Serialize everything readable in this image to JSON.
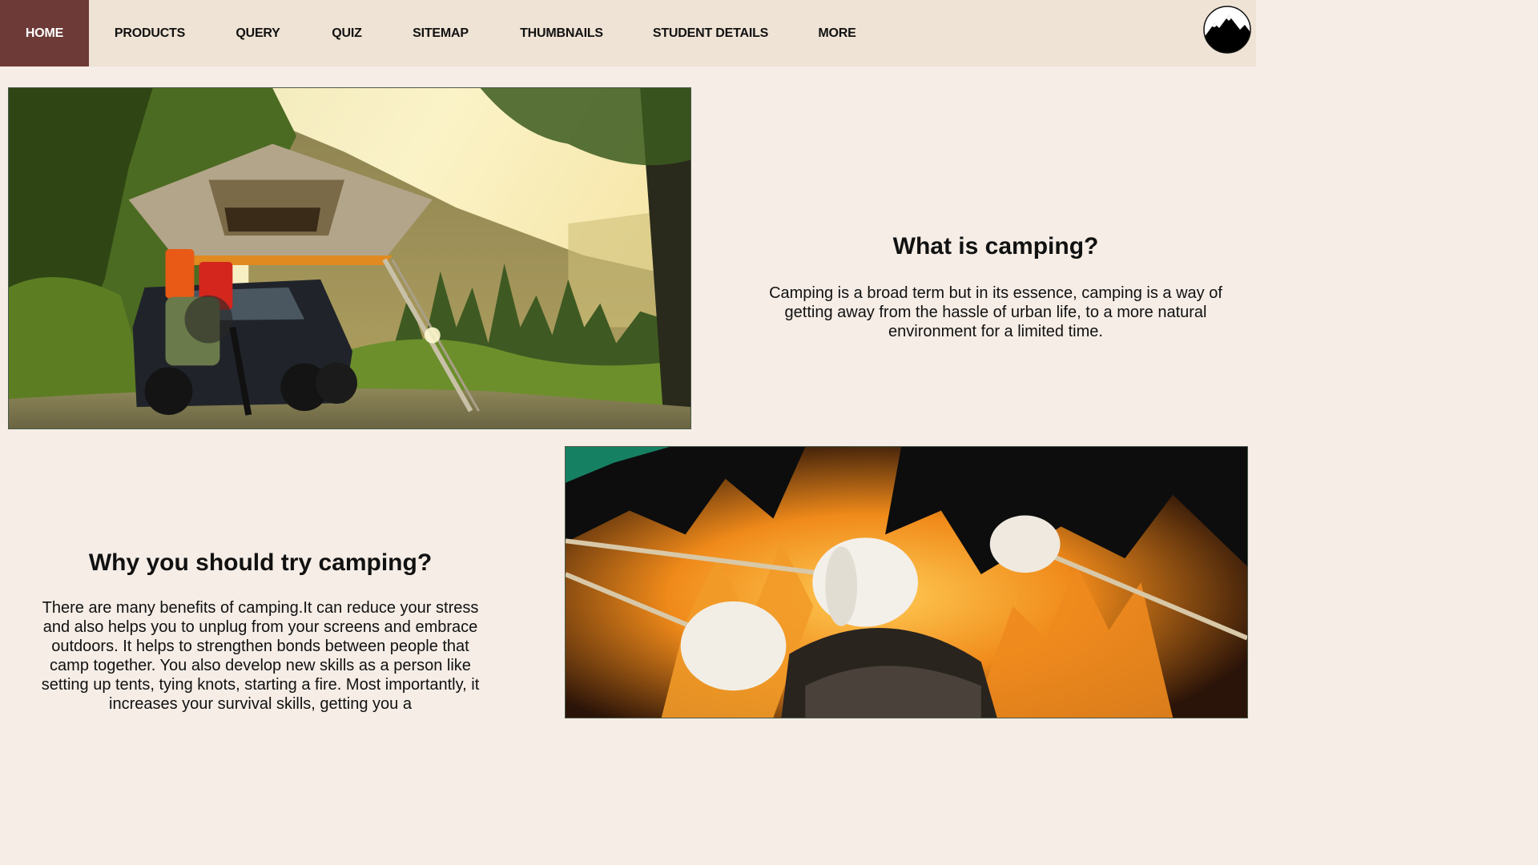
{
  "nav": {
    "items": [
      {
        "label": "HOME",
        "active": true
      },
      {
        "label": "PRODUCTS"
      },
      {
        "label": "QUERY"
      },
      {
        "label": "QUIZ"
      },
      {
        "label": "SITEMAP"
      },
      {
        "label": "THUMBNAILS"
      },
      {
        "label": "STUDENT DETAILS"
      },
      {
        "label": "MORE"
      }
    ],
    "logo_icon": "mountain-logo-icon"
  },
  "section1": {
    "title": "What is camping?",
    "body": "Camping is a broad term but in its essence, camping is a way of getting away from the hassle of urban life, to a more natural environment for a limited time.",
    "image_icon": "camping-car-tent-photo"
  },
  "section2": {
    "title": "Why you should try camping?",
    "body": "There are many benefits of camping.It can reduce your stress and also helps you to unplug from your screens and embrace outdoors. It helps to strengthen bonds between people that camp together. You also develop new skills as a person like setting up tents, tying knots, starting a fire. Most importantly, it increases your survival skills, getting you a",
    "image_icon": "roasting-marshmallows-photo"
  },
  "colors": {
    "nav_bg": "#efe3d5",
    "nav_active": "#6d3a38",
    "page_bg": "#f5ede6"
  }
}
